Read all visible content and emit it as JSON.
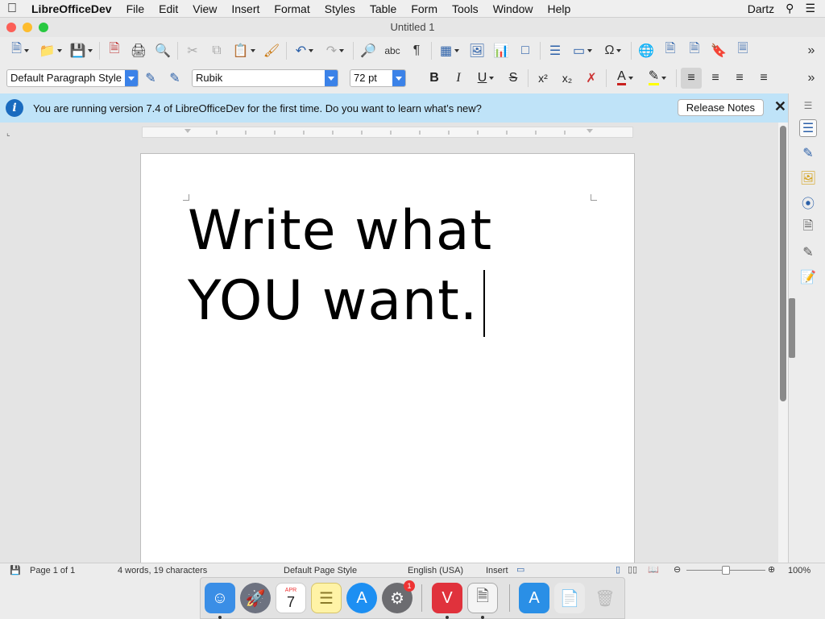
{
  "menubar": {
    "app_name": "LibreOfficeDev",
    "items": [
      "File",
      "Edit",
      "View",
      "Insert",
      "Format",
      "Styles",
      "Table",
      "Form",
      "Tools",
      "Window",
      "Help"
    ],
    "user": "Dartz"
  },
  "window": {
    "title": "Untitled 1"
  },
  "formatting": {
    "paragraph_style": "Default Paragraph Style",
    "font_name": "Rubik",
    "font_size": "72 pt"
  },
  "infobar": {
    "message": "You are running version 7.4 of LibreOfficeDev for the first time. Do you want to learn what’s new?",
    "button_label": "Release Notes"
  },
  "document": {
    "line1": "Write what",
    "line2": "YOU want."
  },
  "statusbar": {
    "page": "Page 1 of 1",
    "word_count": "4 words, 19 characters",
    "page_style": "Default Page Style",
    "language": "English (USA)",
    "insert_mode": "Insert",
    "zoom": "100%"
  },
  "dock": {
    "calendar_month": "APR",
    "calendar_day": "7",
    "badge_count": "1"
  },
  "colors": {
    "accent": "#3b82e8",
    "infobar_bg": "#bfe3f8",
    "font_color_swatch": "#c9211e",
    "highlight_swatch": "#ffff00"
  }
}
